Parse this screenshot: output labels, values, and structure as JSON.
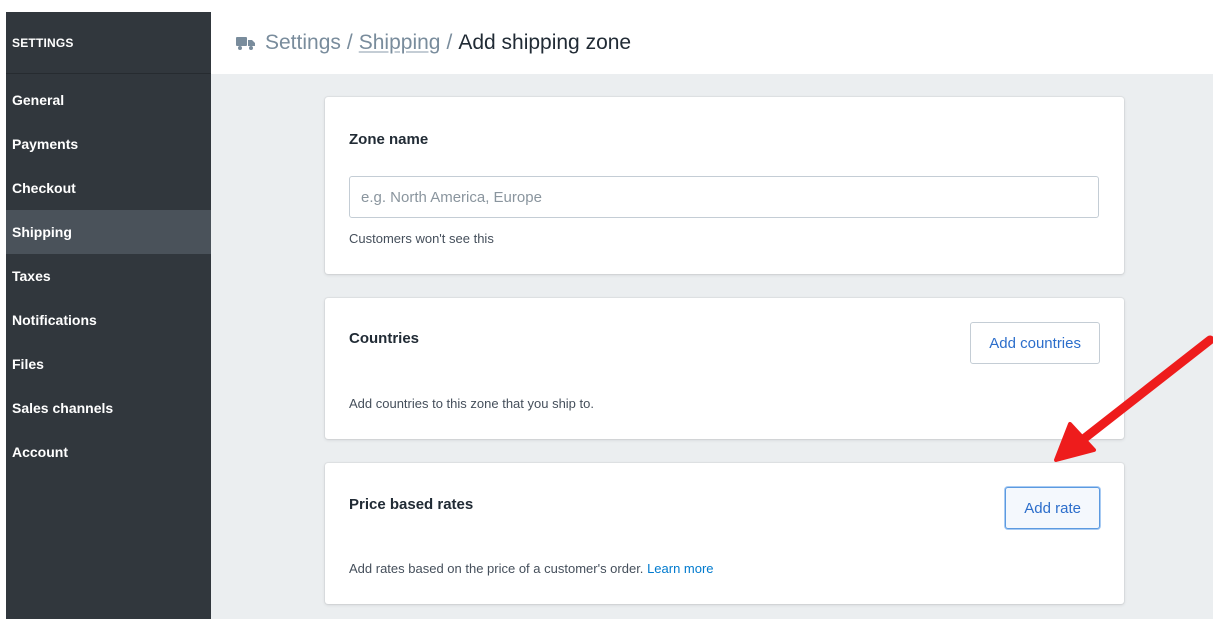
{
  "sidebar": {
    "heading": "SETTINGS",
    "items": [
      {
        "label": "General"
      },
      {
        "label": "Payments"
      },
      {
        "label": "Checkout"
      },
      {
        "label": "Shipping",
        "active": true
      },
      {
        "label": "Taxes"
      },
      {
        "label": "Notifications"
      },
      {
        "label": "Files"
      },
      {
        "label": "Sales channels"
      },
      {
        "label": "Account"
      }
    ]
  },
  "header": {
    "icon": "truck-icon",
    "breadcrumb": [
      {
        "label": "Settings"
      },
      {
        "label": "Shipping"
      },
      {
        "label": "Add shipping zone"
      }
    ],
    "separator": "/"
  },
  "zone_card": {
    "title": "Zone name",
    "input_placeholder": "e.g. North America, Europe",
    "input_value": "",
    "hint": "Customers won't see this"
  },
  "countries_card": {
    "title": "Countries",
    "button_label": "Add countries",
    "hint": "Add countries to this zone that you ship to."
  },
  "rates_card": {
    "title": "Price based rates",
    "button_label": "Add rate",
    "hint": "Add rates based on the price of a customer's order.",
    "learn_more": "Learn more"
  },
  "annotation": {
    "arrow_color": "#ee1c1c",
    "points_to": "add-rate-button"
  },
  "colors": {
    "sidebar_bg": "#31373d",
    "active_item_bg": "#4a525a",
    "main_bg": "#ebeef0",
    "link": "#007ace"
  }
}
